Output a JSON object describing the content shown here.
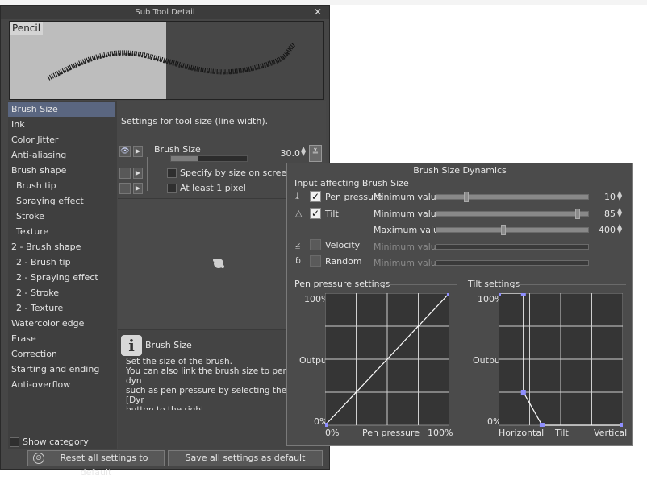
{
  "window": {
    "title": "Sub Tool Detail",
    "close": "✕"
  },
  "preview": {
    "label": "Pencil"
  },
  "categories": [
    {
      "label": "Brush Size",
      "sub": false,
      "selected": true
    },
    {
      "label": "Ink",
      "sub": false
    },
    {
      "label": "Color Jitter",
      "sub": false
    },
    {
      "label": "Anti-aliasing",
      "sub": false
    },
    {
      "label": "Brush shape",
      "sub": false
    },
    {
      "label": "Brush tip",
      "sub": true
    },
    {
      "label": "Spraying effect",
      "sub": true
    },
    {
      "label": "Stroke",
      "sub": true
    },
    {
      "label": "Texture",
      "sub": true
    },
    {
      "label": "2 - Brush shape",
      "sub": false
    },
    {
      "label": "2 - Brush tip",
      "sub": true
    },
    {
      "label": "2 - Spraying effect",
      "sub": true
    },
    {
      "label": "2 - Stroke",
      "sub": true
    },
    {
      "label": "2 - Texture",
      "sub": true
    },
    {
      "label": "Watercolor edge",
      "sub": false
    },
    {
      "label": "Erase",
      "sub": false
    },
    {
      "label": "Correction",
      "sub": false
    },
    {
      "label": "Starting and ending",
      "sub": false
    },
    {
      "label": "Anti-overflow",
      "sub": false
    }
  ],
  "show_category": "Show category",
  "settings": {
    "description": "Settings for tool size (line width).",
    "brush_size": {
      "label": "Brush Size",
      "value": "30.0",
      "level": 0.36
    },
    "options": [
      {
        "label": "Specify by size on screen",
        "checked": false
      },
      {
        "label": "At least 1 pixel",
        "checked": false
      }
    ]
  },
  "info": {
    "title": "Brush Size",
    "text": "Set the size of the brush.\nYou can also link the brush size to pen dyn\nsuch as pen pressure by selecting the [Dyr\nbutton to the right."
  },
  "buttons": {
    "reset": "Reset all settings to default",
    "save": "Save all settings as default"
  },
  "dynamics": {
    "title": "Brush Size Dynamics",
    "input_header": "Input affecting Brush Size",
    "inputs": [
      {
        "label": "Pen pressure",
        "checked": true,
        "enabled": true
      },
      {
        "label": "Tilt",
        "checked": true,
        "enabled": true
      },
      {
        "label": "Velocity",
        "checked": false,
        "enabled": false
      },
      {
        "label": "Random",
        "checked": false,
        "enabled": false
      }
    ],
    "params": [
      {
        "label": "Minimum value",
        "value": "10",
        "level": 0.1,
        "enabled": true
      },
      {
        "label": "Minimum value",
        "value": "85",
        "level": 0.85,
        "enabled": true
      },
      {
        "label": "Maximum value",
        "value": "400",
        "level": 0.35,
        "enabled": true
      },
      {
        "label": "Minimum value",
        "value": "",
        "enabled": false
      },
      {
        "label": "Minimum value",
        "value": "",
        "enabled": false
      }
    ],
    "pen_graph": {
      "header": "Pen pressure settings",
      "y_top": "100%",
      "y_mid": "Output",
      "y_bottom": "0%",
      "x_left": "0%",
      "x_mid": "Pen pressure",
      "x_right": "100%",
      "points": [
        [
          0,
          0
        ],
        [
          1,
          1
        ]
      ]
    },
    "tilt_graph": {
      "header": "Tilt settings",
      "y_top": "100%",
      "y_mid": "Output",
      "y_bottom": "0%",
      "x_left": "Horizontal",
      "x_mid": "Tilt",
      "x_right": "Vertical",
      "points": [
        [
          0,
          1
        ],
        [
          0.2,
          1
        ],
        [
          0.2,
          0.25
        ],
        [
          0.35,
          0
        ],
        [
          1,
          0
        ]
      ]
    },
    "accent": "#8f8fff"
  }
}
